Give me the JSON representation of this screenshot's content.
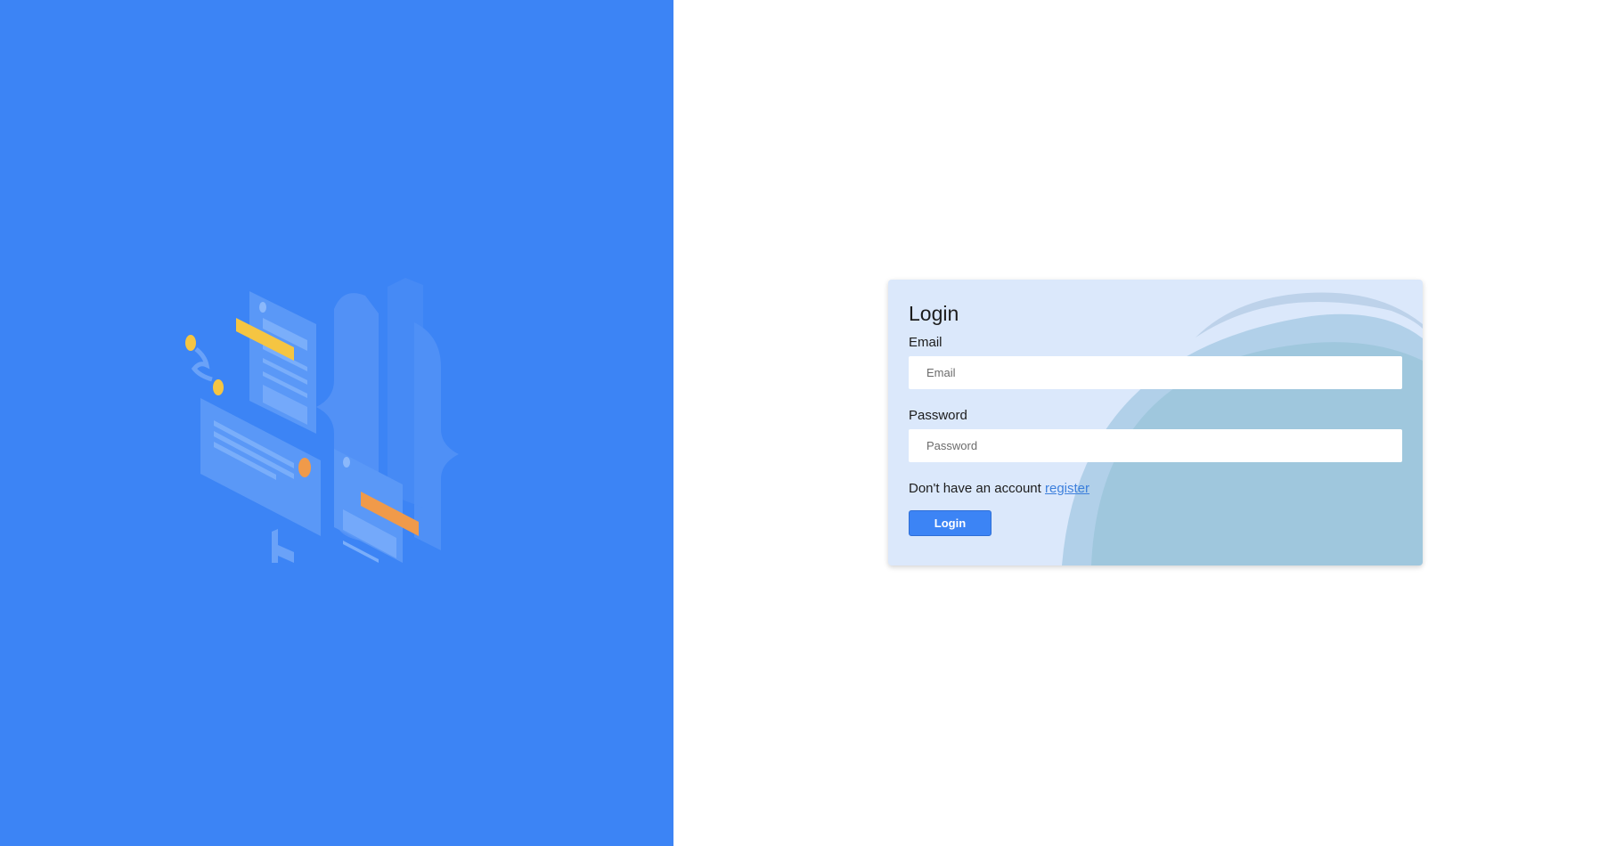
{
  "login": {
    "title": "Login",
    "email_label": "Email",
    "email_placeholder": "Email",
    "email_value": "",
    "password_label": "Password",
    "password_placeholder": "Password",
    "password_value": "",
    "register_prompt": "Don't have an account",
    "register_link": "register",
    "submit_label": "Login"
  },
  "colors": {
    "left_panel": "#3c84f5",
    "card_background": "#dbe8fb",
    "accent": "#3c84f5",
    "link": "#3c7fdc"
  },
  "icons": {
    "illustration": "isometric-code-documents-illustration"
  }
}
